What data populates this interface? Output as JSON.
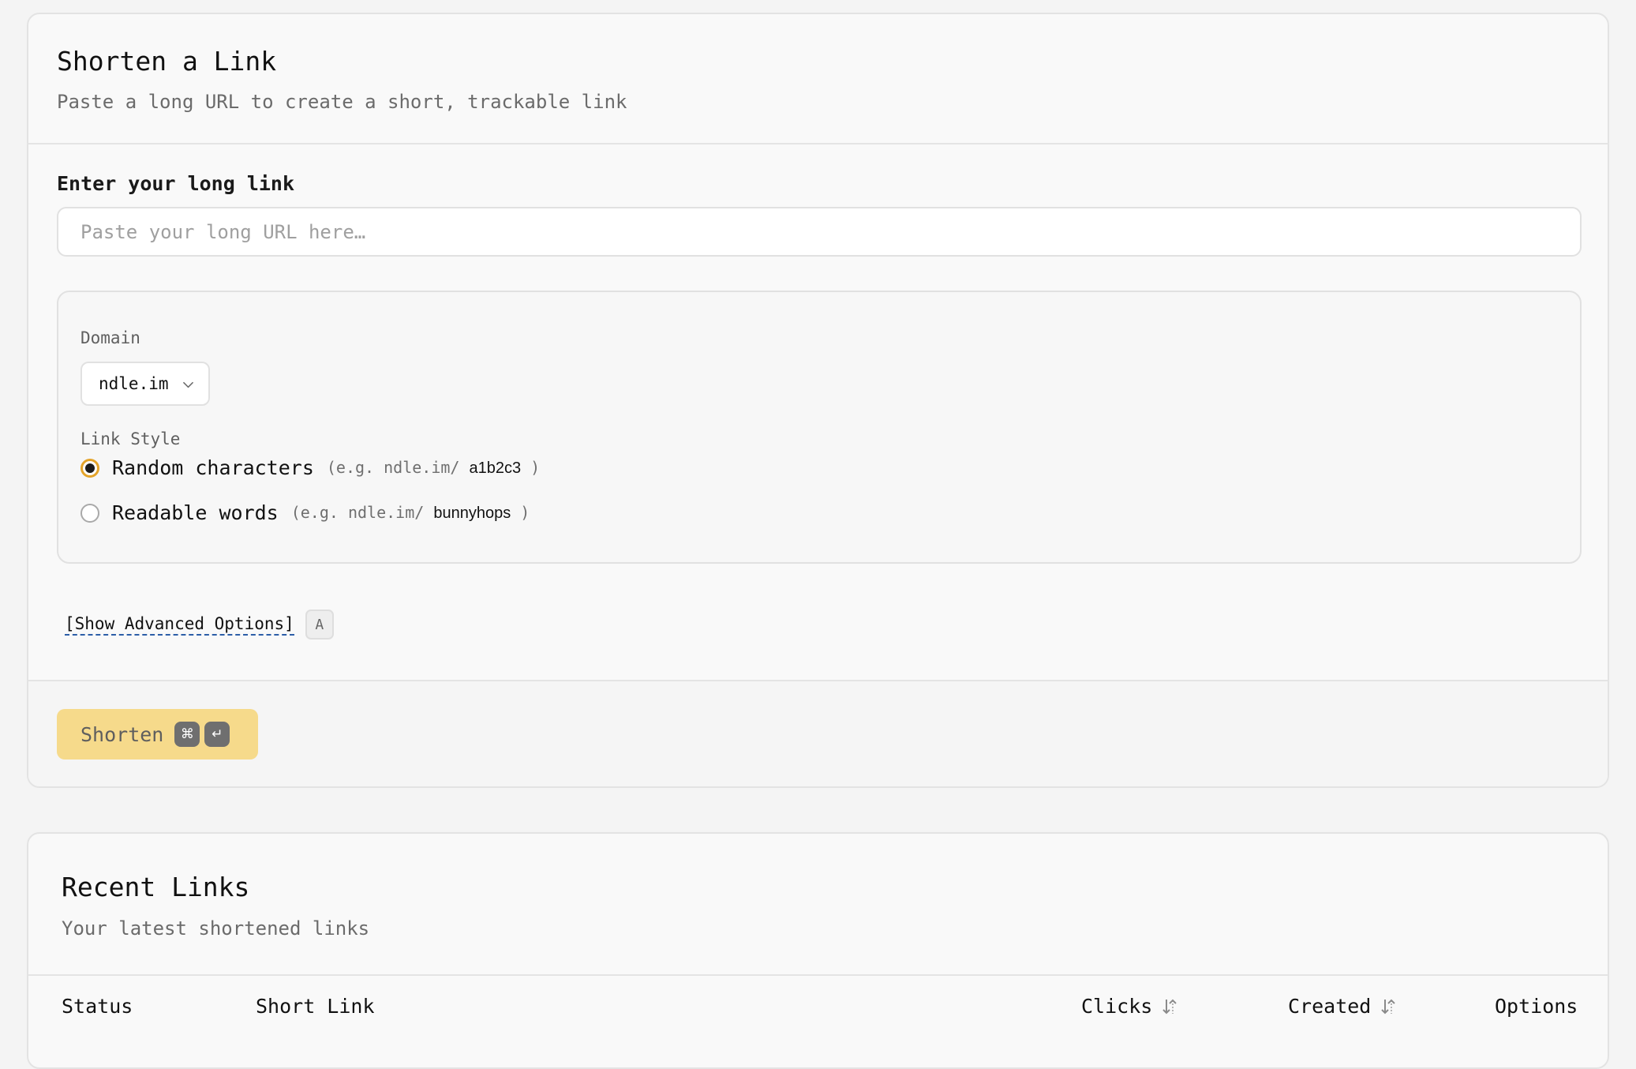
{
  "shorten_card": {
    "title": "Shorten a Link",
    "subtitle": "Paste a long URL to create a short, trackable link",
    "url_label": "Enter your long link",
    "url_placeholder": "Paste your long URL here…",
    "url_value": "",
    "domain_label": "Domain",
    "domain_selected": "ndle.im",
    "link_style_label": "Link Style",
    "link_styles": [
      {
        "label": "Random characters",
        "example_prefix": "(e.g. ndle.im/",
        "example_slug": "a1b2c3",
        "example_suffix": ")",
        "selected": true
      },
      {
        "label": "Readable words",
        "example_prefix": "(e.g. ndle.im/",
        "example_slug": "bunnyhops",
        "example_suffix": ")",
        "selected": false
      }
    ],
    "advanced_toggle": "[Show Advanced Options]",
    "advanced_shortcut": "A",
    "submit_label": "Shorten",
    "submit_shortcut_keys": [
      "⌘",
      "↵"
    ]
  },
  "recent_card": {
    "title": "Recent Links",
    "subtitle": "Your latest shortened links",
    "columns": [
      "Status",
      "Short Link",
      "Clicks",
      "Created",
      "Options"
    ],
    "sortable_columns": [
      "Clicks",
      "Created"
    ]
  },
  "colors": {
    "accent_button": "#f6da8b",
    "radio_selected_ring": "#e4a42a",
    "advanced_underline": "#2c5ea8",
    "page_background": "#f4f4f4"
  },
  "icons": {
    "domain_dropdown": "chevron-down-icon",
    "sort": "sort-icon",
    "command_key": "command-key-icon",
    "enter_key": "enter-key-icon"
  }
}
